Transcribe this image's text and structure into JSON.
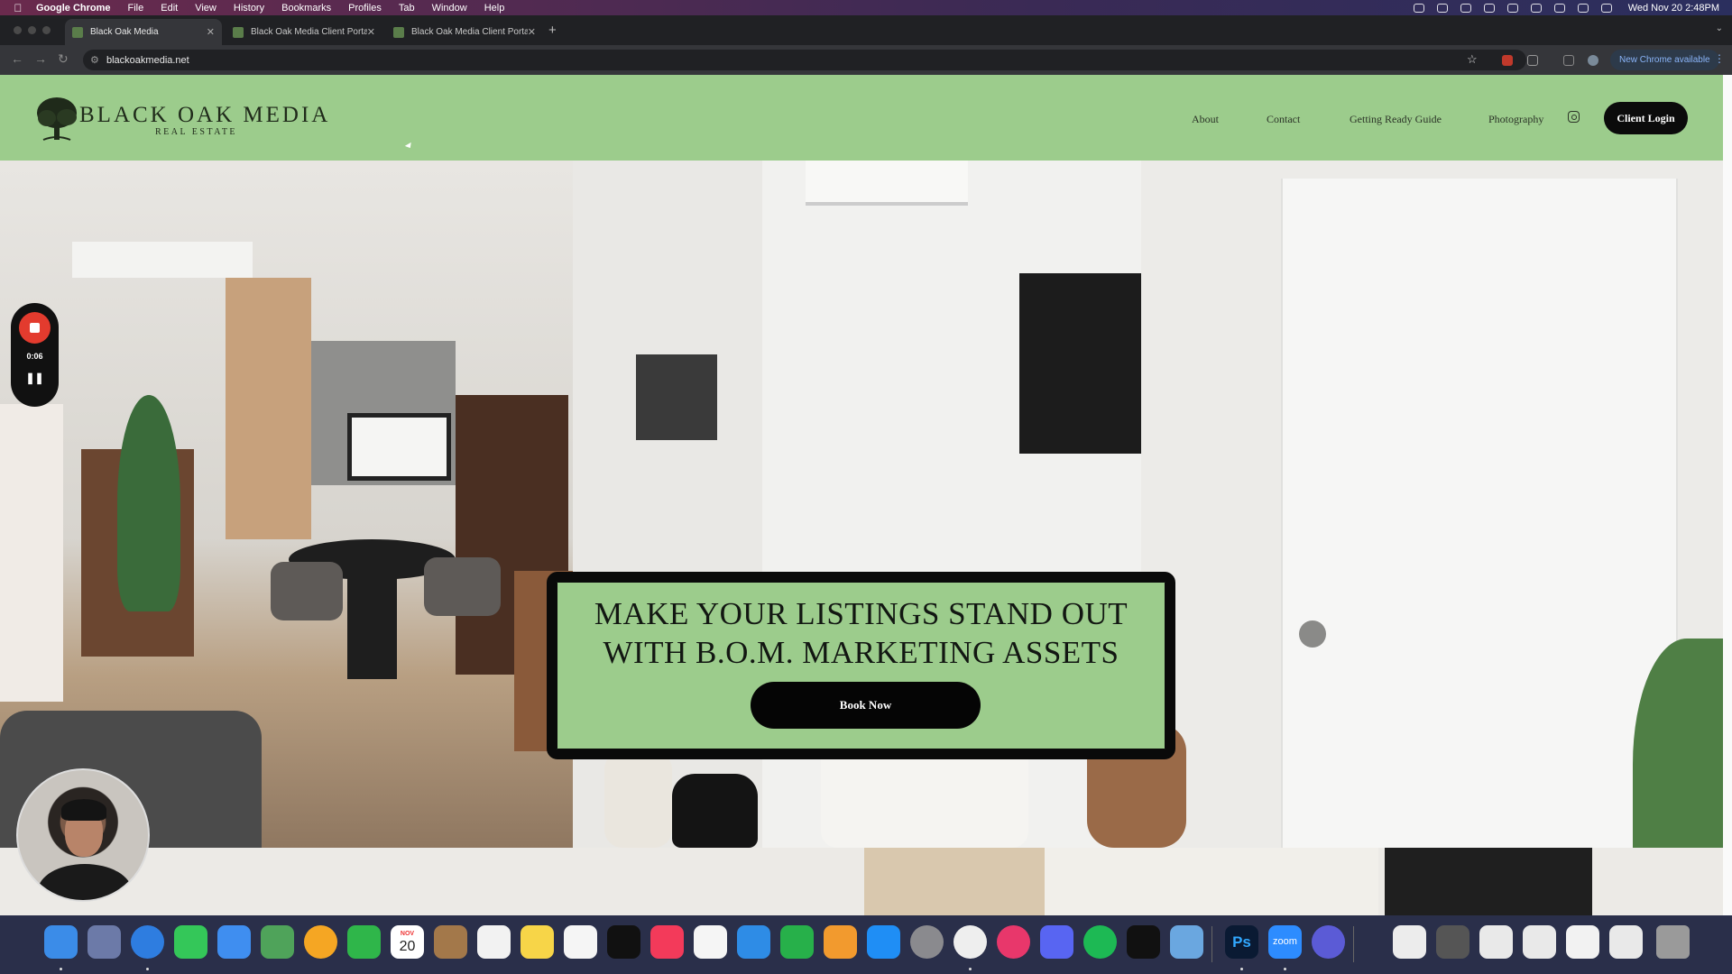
{
  "menubar": {
    "app": "Google Chrome",
    "items": [
      "File",
      "Edit",
      "View",
      "History",
      "Bookmarks",
      "Profiles",
      "Tab",
      "Window",
      "Help"
    ],
    "clock": "Wed Nov 20  2:48PM"
  },
  "tabs": [
    {
      "title": "Black Oak Media",
      "active": true
    },
    {
      "title": "Black Oak Media Client Portal",
      "active": false
    },
    {
      "title": "Black Oak Media Client Portal",
      "active": false
    }
  ],
  "toolbar": {
    "url": "blackoakmedia.net",
    "new_chrome": "New Chrome available"
  },
  "site": {
    "logo_title": "BLACK OAK MEDIA",
    "logo_sub": "REAL ESTATE",
    "nav": [
      "About",
      "Contact",
      "Getting Ready Guide",
      "Photography"
    ],
    "login": "Client Login",
    "headline": "MAKE YOUR LISTINGS STAND OUT WITH B.O.M. MARKETING ASSETS",
    "cta": "Book Now",
    "accent_color": "#9ccc8c"
  },
  "recorder": {
    "time": "0:06"
  },
  "dock": {
    "calendar_month": "NOV",
    "calendar_day": "20",
    "zoom_label": "zoom",
    "ps_label": "Ps"
  }
}
